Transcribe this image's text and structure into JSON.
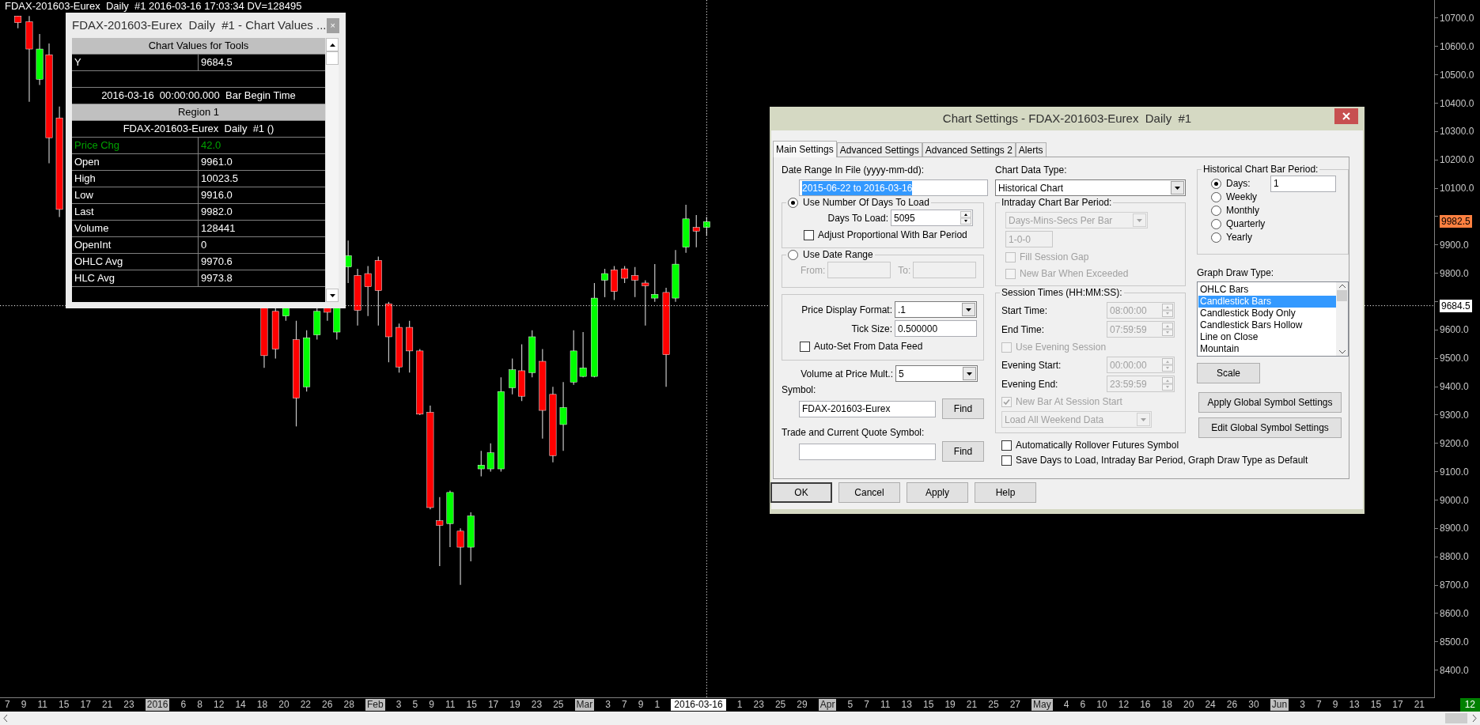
{
  "chart": {
    "title": "FDAX-201603-Eurex  Daily  #1 2016-03-16 17:03:34 DV=128495",
    "price_axis": [
      {
        "kind": "tick",
        "text": "10700.0"
      },
      {
        "kind": "tick",
        "text": "10600.0"
      },
      {
        "kind": "tick",
        "text": "10500.0"
      },
      {
        "kind": "tick",
        "text": "10400.0"
      },
      {
        "kind": "tick",
        "text": "10300.0"
      },
      {
        "kind": "tick",
        "text": "10200.0"
      },
      {
        "kind": "tick",
        "text": "10100.0"
      },
      {
        "kind": "last",
        "text": "9982.5"
      },
      {
        "kind": "tick",
        "text": "9900.0"
      },
      {
        "kind": "tick",
        "text": "9800.0"
      },
      {
        "kind": "cursor",
        "text": "9684.5"
      },
      {
        "kind": "tick",
        "text": "9600.0"
      },
      {
        "kind": "tick",
        "text": "9500.0"
      },
      {
        "kind": "tick",
        "text": "9400.0"
      },
      {
        "kind": "tick",
        "text": "9300.0"
      },
      {
        "kind": "tick",
        "text": "9200.0"
      },
      {
        "kind": "tick",
        "text": "9100.0"
      },
      {
        "kind": "tick",
        "text": "9000.0"
      },
      {
        "kind": "tick",
        "text": "8900.0"
      },
      {
        "kind": "tick",
        "text": "8800.0"
      },
      {
        "kind": "tick",
        "text": "8700.0"
      },
      {
        "kind": "tick",
        "text": "8600.0"
      },
      {
        "kind": "tick",
        "text": "8500.0"
      },
      {
        "kind": "tick",
        "text": "8400.0"
      }
    ],
    "time_labels": [
      {
        "kind": "day",
        "text": "7"
      },
      {
        "kind": "day",
        "text": "9"
      },
      {
        "kind": "day",
        "text": "11"
      },
      {
        "kind": "day",
        "text": "15"
      },
      {
        "kind": "day",
        "text": "17"
      },
      {
        "kind": "day",
        "text": "21"
      },
      {
        "kind": "day",
        "text": "23"
      },
      {
        "kind": "month",
        "text": "2016"
      },
      {
        "kind": "day",
        "text": "6"
      },
      {
        "kind": "day",
        "text": "8"
      },
      {
        "kind": "day",
        "text": "12"
      },
      {
        "kind": "day",
        "text": "14"
      },
      {
        "kind": "day",
        "text": "18"
      },
      {
        "kind": "day",
        "text": "20"
      },
      {
        "kind": "day",
        "text": "22"
      },
      {
        "kind": "day",
        "text": "26"
      },
      {
        "kind": "day",
        "text": "28"
      },
      {
        "kind": "month",
        "text": "Feb"
      },
      {
        "kind": "day",
        "text": "3"
      },
      {
        "kind": "day",
        "text": "5"
      },
      {
        "kind": "day",
        "text": "9"
      },
      {
        "kind": "day",
        "text": "11"
      },
      {
        "kind": "day",
        "text": "15"
      },
      {
        "kind": "day",
        "text": "17"
      },
      {
        "kind": "day",
        "text": "19"
      },
      {
        "kind": "day",
        "text": "23"
      },
      {
        "kind": "day",
        "text": "25"
      },
      {
        "kind": "month",
        "text": "Mar"
      },
      {
        "kind": "day",
        "text": "3"
      },
      {
        "kind": "day",
        "text": "7"
      },
      {
        "kind": "day",
        "text": "9"
      },
      {
        "kind": "day",
        "text": "1"
      },
      {
        "kind": "cursor",
        "text": "2016-03-16"
      },
      {
        "kind": "day",
        "text": "1"
      },
      {
        "kind": "day",
        "text": "23"
      },
      {
        "kind": "day",
        "text": "25"
      },
      {
        "kind": "day",
        "text": "29"
      },
      {
        "kind": "month",
        "text": "Apr"
      },
      {
        "kind": "day",
        "text": "5"
      },
      {
        "kind": "day",
        "text": "7"
      },
      {
        "kind": "day",
        "text": "11"
      },
      {
        "kind": "day",
        "text": "13"
      },
      {
        "kind": "day",
        "text": "15"
      },
      {
        "kind": "day",
        "text": "19"
      },
      {
        "kind": "day",
        "text": "21"
      },
      {
        "kind": "day",
        "text": "25"
      },
      {
        "kind": "day",
        "text": "27"
      },
      {
        "kind": "month",
        "text": "May"
      },
      {
        "kind": "day",
        "text": "4"
      },
      {
        "kind": "day",
        "text": "6"
      },
      {
        "kind": "day",
        "text": "10"
      },
      {
        "kind": "day",
        "text": "12"
      },
      {
        "kind": "day",
        "text": "16"
      },
      {
        "kind": "day",
        "text": "18"
      },
      {
        "kind": "day",
        "text": "20"
      },
      {
        "kind": "day",
        "text": "24"
      },
      {
        "kind": "day",
        "text": "26"
      },
      {
        "kind": "day",
        "text": "30"
      },
      {
        "kind": "month",
        "text": "Jun"
      },
      {
        "kind": "day",
        "text": "3"
      },
      {
        "kind": "day",
        "text": "7"
      },
      {
        "kind": "day",
        "text": "9"
      },
      {
        "kind": "day",
        "text": "13"
      },
      {
        "kind": "day",
        "text": "15"
      },
      {
        "kind": "day",
        "text": "17"
      },
      {
        "kind": "day",
        "text": "21"
      }
    ],
    "bar_count": "12"
  },
  "values_window": {
    "title": "FDAX-201603-Eurex  Daily  #1 - Chart Values ...",
    "close": "×",
    "rows": [
      {
        "kind": "header",
        "text": "Chart Values for Tools"
      },
      {
        "kind": "pair",
        "label": "Y",
        "value": "9684.5",
        "highlight": false
      },
      {
        "kind": "blank"
      },
      {
        "kind": "center",
        "text": "2016-03-16  00:00:00.000  Bar Begin Time"
      },
      {
        "kind": "header",
        "text": "Region 1"
      },
      {
        "kind": "center",
        "text": "FDAX-201603-Eurex  Daily  #1 ()"
      },
      {
        "kind": "pair",
        "label": "Price Chg",
        "value": "42.0",
        "highlight": true
      },
      {
        "kind": "pair",
        "label": "Open",
        "value": "9961.0",
        "highlight": false
      },
      {
        "kind": "pair",
        "label": "High",
        "value": "10023.5",
        "highlight": false
      },
      {
        "kind": "pair",
        "label": "Low",
        "value": "9916.0",
        "highlight": false
      },
      {
        "kind": "pair",
        "label": "Last",
        "value": "9982.0",
        "highlight": false
      },
      {
        "kind": "pair",
        "label": "Volume",
        "value": "128441",
        "highlight": false
      },
      {
        "kind": "pair",
        "label": "OpenInt",
        "value": "0",
        "highlight": false
      },
      {
        "kind": "pair",
        "label": "OHLC Avg",
        "value": "9970.6",
        "highlight": false
      },
      {
        "kind": "pair",
        "label": "HLC Avg",
        "value": "9973.8",
        "highlight": false
      }
    ]
  },
  "settings": {
    "title": "Chart Settings - FDAX-201603-Eurex  Daily  #1",
    "tabs": [
      {
        "label": "Main Settings",
        "selected": true
      },
      {
        "label": "Advanced Settings",
        "selected": false
      },
      {
        "label": "Advanced Settings 2",
        "selected": false
      },
      {
        "label": "Alerts",
        "selected": false
      }
    ],
    "date_range": {
      "label": "Date Range In File (yyyy-mm-dd):",
      "value": "2015-06-22 to 2016-03-16"
    },
    "days_mode": {
      "label": "Use Number Of Days To Load",
      "selected": true,
      "days_label": "Days To Load:",
      "days_value": "5095",
      "adjust": {
        "label": "Adjust Proportional With Bar Period",
        "checked": false
      }
    },
    "range_mode": {
      "label": "Use Date Range",
      "selected": false,
      "disabled": true,
      "from_label": "From:",
      "to_label": "To:"
    },
    "price_format": {
      "label": "Price Display Format:",
      "value": ".1"
    },
    "tick_size": {
      "label": "Tick Size:",
      "value": "0.500000"
    },
    "auto_set": {
      "label": "Auto-Set From Data Feed",
      "checked": false
    },
    "volume_mult": {
      "label": "Volume at Price Mult.:",
      "value": "5"
    },
    "symbol": {
      "label": "Symbol:",
      "value": "FDAX-201603-Eurex",
      "button": "Find"
    },
    "quote_symbol": {
      "label": "Trade and Current Quote Symbol:",
      "button": "Find"
    },
    "data_type": {
      "label": "Chart Data Type:",
      "value": "Historical Chart"
    },
    "intraday": {
      "label": "Intraday Chart Bar Period:",
      "disabled": true,
      "type": "Days-Mins-Secs Per Bar",
      "period": "1-0-0",
      "checks": [
        {
          "label": "Fill Session Gap",
          "checked": false
        },
        {
          "label": "New Bar When Exceeded",
          "checked": false
        }
      ]
    },
    "session": {
      "label": "Session Times (HH:MM:SS):",
      "disabled": true,
      "times": [
        {
          "label": "Start Time:",
          "value": "08:00:00"
        },
        {
          "label": "End Time:",
          "value": "07:59:59"
        }
      ],
      "evening_check": {
        "label": "Use Evening Session",
        "checked": false
      },
      "evening_times": [
        {
          "label": "Evening Start:",
          "value": "00:00:00"
        },
        {
          "label": "Evening End:",
          "value": "23:59:59"
        }
      ],
      "new_bar": {
        "label": "New Bar At Session Start",
        "checked": true
      },
      "weekend": "Load All Weekend Data"
    },
    "options": [
      {
        "label": "Automatically Rollover Futures Symbol",
        "checked": false
      },
      {
        "label": "Save Days to Load, Intraday Bar Period, Graph Draw Type as Default",
        "checked": false
      }
    ],
    "bar_period": {
      "label": "Historical Chart Bar Period:",
      "days_value": "1",
      "options": [
        {
          "label": "Days:",
          "selected": true
        },
        {
          "label": "Weekly",
          "selected": false
        },
        {
          "label": "Monthly",
          "selected": false
        },
        {
          "label": "Quarterly",
          "selected": false
        },
        {
          "label": "Yearly",
          "selected": false
        }
      ]
    },
    "draw_type": {
      "label": "Graph Draw Type:",
      "items": [
        {
          "label": "OHLC Bars",
          "selected": false
        },
        {
          "label": "Candlestick Bars",
          "selected": true
        },
        {
          "label": "Candlestick Body Only",
          "selected": false
        },
        {
          "label": "Candlestick Bars Hollow",
          "selected": false
        },
        {
          "label": "Line on Close",
          "selected": false
        },
        {
          "label": "Mountain",
          "selected": false
        }
      ]
    },
    "scale_button": "Scale",
    "global_buttons": [
      "Apply Global Symbol Settings",
      "Edit Global Symbol Settings"
    ],
    "buttons": [
      {
        "label": "OK",
        "default": true
      },
      {
        "label": "Cancel",
        "default": false
      },
      {
        "label": "Apply",
        "default": false
      },
      {
        "label": "Help",
        "default": false
      }
    ]
  }
}
